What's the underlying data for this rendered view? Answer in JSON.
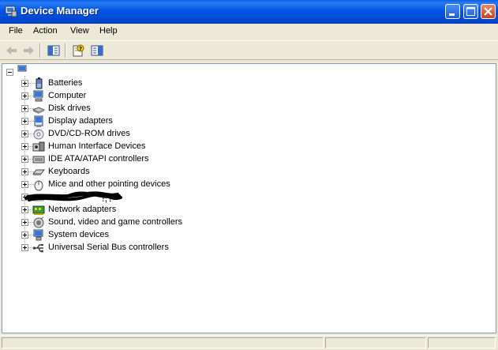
{
  "window": {
    "title": "Device Manager",
    "colors": {
      "titlebar": "#0054e3",
      "close": "#c8421e",
      "background": "#ece9d8"
    }
  },
  "menu": [
    "File",
    "Action",
    "View",
    "Help"
  ],
  "toolbar": {
    "buttons": [
      "back-arrow-icon",
      "forward-arrow-icon",
      "show-hide-tree-icon",
      "properties-help-icon",
      "view-toggle-icon"
    ]
  },
  "tree": {
    "root_label": "",
    "items": [
      {
        "label": "Batteries",
        "icon": "battery-icon"
      },
      {
        "label": "Computer",
        "icon": "computer-icon"
      },
      {
        "label": "Disk drives",
        "icon": "disk-drive-icon"
      },
      {
        "label": "Display adapters",
        "icon": "display-adapter-icon"
      },
      {
        "label": "DVD/CD-ROM drives",
        "icon": "dvd-drive-icon"
      },
      {
        "label": "Human Interface Devices",
        "icon": "hid-icon"
      },
      {
        "label": "IDE ATA/ATAPI controllers",
        "icon": "ide-controller-icon"
      },
      {
        "label": "Keyboards",
        "icon": "keyboard-icon"
      },
      {
        "label": "Mice and other pointing devices",
        "icon": "mouse-icon"
      },
      {
        "label": "!,?",
        "icon": "redacted-device-icon"
      },
      {
        "label": "Network adapters",
        "icon": "network-adapter-icon"
      },
      {
        "label": "Sound, video and game controllers",
        "icon": "sound-icon"
      },
      {
        "label": "System devices",
        "icon": "system-devices-icon"
      },
      {
        "label": "Universal Serial Bus controllers",
        "icon": "usb-icon"
      }
    ]
  }
}
